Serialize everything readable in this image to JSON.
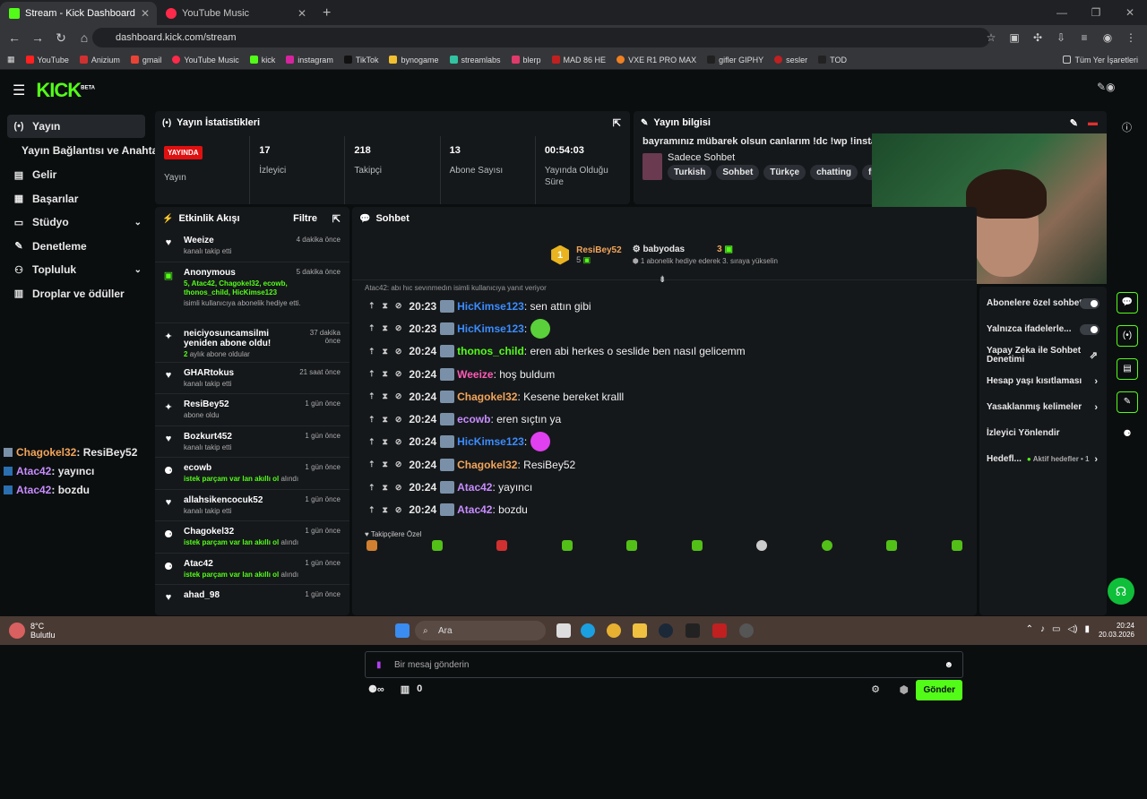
{
  "browser": {
    "tabs": [
      {
        "label": "Stream - Kick Dashboard",
        "color": "#53fc18"
      },
      {
        "label": "YouTube Music",
        "color": "#ff2a4a"
      }
    ],
    "url": "dashboard.kick.com/stream",
    "bookmarks": [
      "YouTube",
      "Anizium",
      "gmail",
      "YouTube Music",
      "kick",
      "instagram",
      "TikTok",
      "bynogame",
      "streamlabs",
      "blerp",
      "MAD 86 HE",
      "VXE R1 PRO MAX",
      "gifler GIPHY",
      "sesler",
      "TOD"
    ],
    "bookmarks_right": "Tüm Yer İşaretleri"
  },
  "app": {
    "logo": "KICK",
    "logo_sup": "BETA"
  },
  "sidebar": {
    "items": [
      {
        "label": "Yayın",
        "icon": "(•)"
      },
      {
        "label": "Yayın Bağlantısı ve Anahtarı",
        "icon": ""
      },
      {
        "label": "Gelir",
        "icon": "▤"
      },
      {
        "label": "Başarılar",
        "icon": "▦"
      },
      {
        "label": "Stüdyo",
        "icon": "▭"
      },
      {
        "label": "Denetleme",
        "icon": "✎"
      },
      {
        "label": "Topluluk",
        "icon": "⚇"
      },
      {
        "label": "Droplar ve ödüller",
        "icon": "▥"
      }
    ]
  },
  "overlay_chat": [
    {
      "user": "Chagokel32",
      "text": " : ResiBey52",
      "color": "#f2a55a"
    },
    {
      "user": "Atac42",
      "text": " : yayıncı",
      "color": "#c78cff"
    },
    {
      "user": "Atac42",
      "text": " : bozdu",
      "color": "#c78cff"
    }
  ],
  "stats": {
    "title": "Yayın İstatistikleri",
    "live_badge": "YAYINDA",
    "items": [
      {
        "value": "",
        "label": "Yayın"
      },
      {
        "value": "17",
        "label": "İzleyici"
      },
      {
        "value": "218",
        "label": "Takipçi"
      },
      {
        "value": "13",
        "label": "Abone Sayısı"
      },
      {
        "value": "00:54:03",
        "label": "Yayında Olduğu Süre"
      }
    ]
  },
  "info": {
    "title": "Yayın bilgisi",
    "stream_title": "bayramınız mübarek olsun canlarım !dc !wp !insta !bynog",
    "category": "Sadece Sohbet",
    "tags": [
      "Turkish",
      "Sohbet",
      "Türkçe",
      "chatting",
      "fps"
    ]
  },
  "activity": {
    "title": "Etkinlik Akışı",
    "filter": "Filtre",
    "items": [
      {
        "icon": "♥",
        "name": "Weeize",
        "sub": "kanalı takip etti",
        "time": "4 dakika önce"
      },
      {
        "icon": "▣",
        "name": "Anonymous",
        "sub": "",
        "green": "5, Atac42, Chagokel32, ecowb, thonos_child, HicKimse123",
        "sub2": "isimli kullanıcıya abonelik hediye etti.",
        "time": "5 dakika önce"
      },
      {
        "icon": "✦",
        "name": "neiciyosuncamsilmi yeniden abone oldu!",
        "sub": "aylık abone oldular",
        "green": "2",
        "time": "37 dakika önce"
      },
      {
        "icon": "♥",
        "name": "GHARtokus",
        "sub": "kanalı takip etti",
        "time": "21 saat önce"
      },
      {
        "icon": "✦",
        "name": "ResiBey52",
        "sub": "abone oldu",
        "time": "1 gün önce"
      },
      {
        "icon": "♥",
        "name": "Bozkurt452",
        "sub": "kanalı takip etti",
        "time": "1 gün önce"
      },
      {
        "icon": "⚈",
        "name": "ecowb",
        "green": "istek parçam var lan akıllı ol",
        "sub2": "alındı",
        "time": "1 gün önce"
      },
      {
        "icon": "♥",
        "name": "allahsikencocuk52",
        "sub": "kanalı takip etti",
        "time": "1 gün önce"
      },
      {
        "icon": "⚈",
        "name": "Chagokel32",
        "green": "istek parçam var lan akıllı ol",
        "sub2": "alındı",
        "time": "1 gün önce"
      },
      {
        "icon": "⚈",
        "name": "Atac42",
        "green": "istek parçam var lan akıllı ol",
        "sub2": "alındı",
        "time": "1 gün önce"
      },
      {
        "icon": "♥",
        "name": "ahad_98",
        "sub": "",
        "time": "1 gün önce"
      }
    ]
  },
  "chat": {
    "title": "Sohbet",
    "top": {
      "rank": "1",
      "user1": "ResiBey52",
      "count1": "5",
      "user2": "babyodas",
      "count2": "3",
      "note": "1 abonelik hediye ederek 3. sıraya yükselin"
    },
    "reply_note": "Atac42: abı hıc sevınmedın isimli kullanıcıya yanıt veriyor",
    "messages": [
      {
        "time": "20:23",
        "user": "HicKimse123",
        "color": "#3b8cff",
        "text": ": sen attın gibi",
        "emote": ""
      },
      {
        "time": "20:23",
        "user": "HicKimse123",
        "color": "#3b8cff",
        "text": ":",
        "emote": "#5ad03a"
      },
      {
        "time": "20:24",
        "user": "thonos_child",
        "color": "#53fc18",
        "text": ": eren abi herkes o seslide ben nasıl gelicemm",
        "emote": ""
      },
      {
        "time": "20:24",
        "user": "Weeize",
        "color": "#ff5ab5",
        "text": ": hoş buldum",
        "emote": ""
      },
      {
        "time": "20:24",
        "user": "Chagokel32",
        "color": "#f2a55a",
        "text": ": Kesene bereket kralll",
        "emote": ""
      },
      {
        "time": "20:24",
        "user": "ecowb",
        "color": "#c78cff",
        "text": ": eren sıçtın ya",
        "emote": ""
      },
      {
        "time": "20:24",
        "user": "HicKimse123",
        "color": "#3b8cff",
        "text": ":",
        "emote": "#e040f0"
      },
      {
        "time": "20:24",
        "user": "Chagokel32",
        "color": "#f2a55a",
        "text": ": ResiBey52",
        "emote": ""
      },
      {
        "time": "20:24",
        "user": "Atac42",
        "color": "#c78cff",
        "text": ": yayıncı",
        "emote": ""
      },
      {
        "time": "20:24",
        "user": "Atac42",
        "color": "#c78cff",
        "text": ": bozdu",
        "emote": ""
      }
    ],
    "followers_only": "Takipçilere Özel",
    "placeholder": "Bir mesaj gönderin",
    "points": "0",
    "send": "Gönder"
  },
  "settings": {
    "items": [
      {
        "label": "Abonelere özel sohbet",
        "type": "toggle"
      },
      {
        "label": "Yalnızca ifadelerle...",
        "type": "toggle"
      },
      {
        "label": "Yapay Zeka ile Sohbet Denetimi",
        "type": "link"
      },
      {
        "label": "Hesap yaşı kısıtlaması",
        "type": "arrow"
      },
      {
        "label": "Yasaklanmış kelimeler",
        "type": "arrow"
      },
      {
        "label": "İzleyici Yönlendir",
        "type": "none"
      },
      {
        "label": "Hedefl...",
        "type": "arrow",
        "extra": "Aktif hedefler • 1"
      }
    ]
  },
  "taskbar": {
    "temp": "8°C",
    "weather": "Bulutlu",
    "search": "Ara",
    "time": "20:24",
    "date": "20.03.2026"
  }
}
